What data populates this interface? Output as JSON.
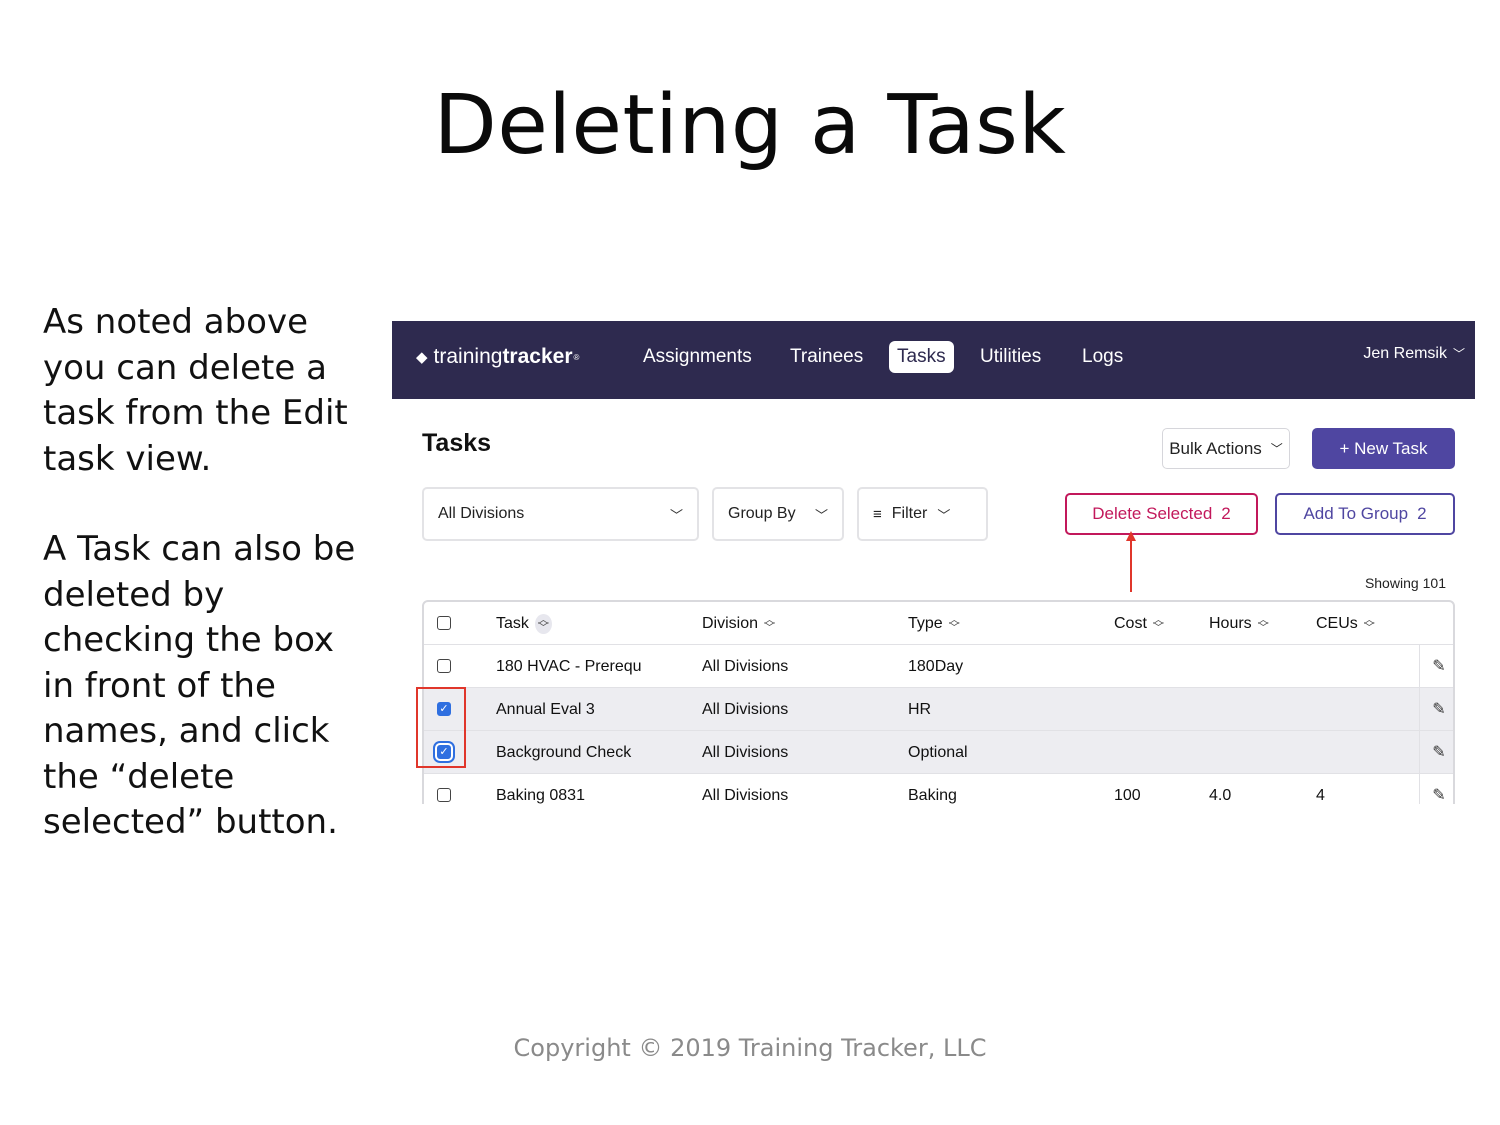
{
  "slide": {
    "title": "Deleting a Task",
    "paragraphs": [
      "As noted above you can delete a task from the Edit task view.",
      "A Task can also be deleted by checking the box in front of the names, and click the  “delete selected” button."
    ],
    "copyright": "Copyright © 2019 Training Tracker, LLC"
  },
  "app": {
    "brand": {
      "light": "training",
      "bold": "tracker",
      "mark": "®",
      "icon": "diamond-logo-icon"
    },
    "nav": [
      {
        "label": "Assignments",
        "active": false
      },
      {
        "label": "Trainees",
        "active": false
      },
      {
        "label": "Tasks",
        "active": true
      },
      {
        "label": "Utilities",
        "active": false
      },
      {
        "label": "Logs",
        "active": false
      }
    ],
    "user": "Jen Remsik",
    "page_title": "Tasks",
    "actions": {
      "bulk_actions": "Bulk Actions",
      "new_task": "+ New Task",
      "delete_selected": "Delete Selected",
      "delete_count": "2",
      "add_to_group": "Add To Group",
      "add_count": "2"
    },
    "filters": {
      "divisions": "All Divisions",
      "group_by": "Group By",
      "filter": "Filter"
    },
    "showing": {
      "label": "Showing",
      "count": "101"
    },
    "table": {
      "columns": [
        "Task",
        "Division",
        "Type",
        "Cost",
        "Hours",
        "CEUs"
      ],
      "rows": [
        {
          "task": "180 HVAC - Prerequ",
          "division": "All Divisions",
          "type": "180Day",
          "cost": "",
          "hours": "",
          "ceus": "",
          "checked": false
        },
        {
          "task": "Annual Eval 3",
          "division": "All Divisions",
          "type": "HR",
          "cost": "",
          "hours": "",
          "ceus": "",
          "checked": true
        },
        {
          "task": "Background Check",
          "division": "All Divisions",
          "type": "Optional",
          "cost": "",
          "hours": "",
          "ceus": "",
          "checked": true
        },
        {
          "task": "Baking 0831",
          "division": "All Divisions",
          "type": "Baking",
          "cost": "100",
          "hours": "4.0",
          "ceus": "4",
          "checked": false
        }
      ]
    },
    "colors": {
      "navbar": "#2e2a4f",
      "primary": "#4f46a1",
      "danger": "#c2185b",
      "checkbox": "#2f6fe0",
      "annotation": "#e0362b"
    }
  }
}
